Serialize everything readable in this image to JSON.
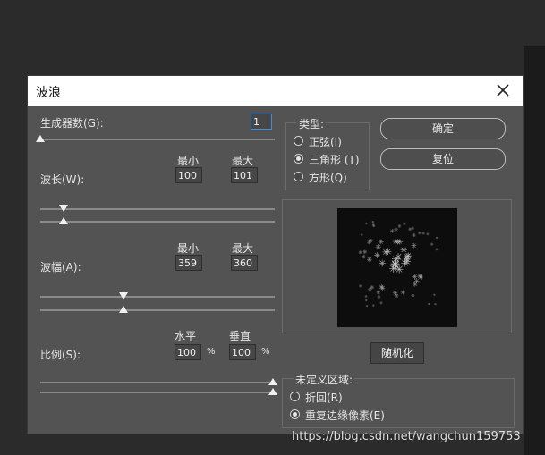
{
  "dialog": {
    "title": "波浪"
  },
  "generators": {
    "label": "生成器数(G):",
    "value": "1"
  },
  "wavelength": {
    "label": "波长(W):",
    "min_label": "最小",
    "max_label": "最大",
    "min_value": "100",
    "max_value": "101"
  },
  "amplitude": {
    "label": "波幅(A):",
    "min_label": "最小",
    "max_label": "最大",
    "min_value": "359",
    "max_value": "360"
  },
  "scale": {
    "label": "比例(S):",
    "horizontal_label": "水平",
    "vertical_label": "垂直",
    "horizontal_value": "100",
    "vertical_value": "100",
    "unit": "%"
  },
  "type_group": {
    "label": "类型:",
    "options": [
      "正弦(I)",
      "三角形 (T)",
      "方形(Q)"
    ],
    "selected": "三角形 (T)"
  },
  "buttons": {
    "ok": "确定",
    "reset": "复位",
    "randomize": "随机化"
  },
  "undefined_area": {
    "label": "未定义区域:",
    "options": [
      "折回(R)",
      "重复边缘像素(E)"
    ],
    "selected": "重复边缘像素(E)"
  },
  "watermark": "https://blog.csdn.net/wangchun159753",
  "colors": {
    "dialog_bg": "#535353",
    "titlebar_bg": "#ffffff",
    "page_bg": "#2b2b2b"
  }
}
